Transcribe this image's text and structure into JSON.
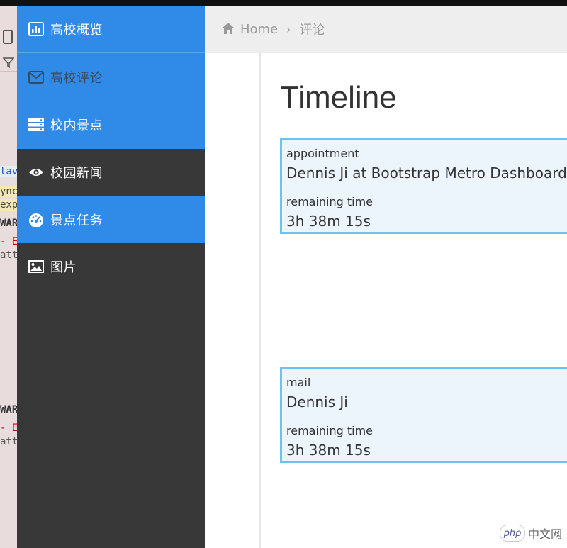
{
  "sidebar": {
    "items": [
      {
        "label": "高校概览",
        "icon": "bar-chart-icon"
      },
      {
        "label": "高校评论",
        "icon": "envelope-icon"
      },
      {
        "label": "校内景点",
        "icon": "server-icon"
      },
      {
        "label": "校园新闻",
        "icon": "eye-icon"
      },
      {
        "label": "景点任务",
        "icon": "dashboard-icon"
      },
      {
        "label": "图片",
        "icon": "image-icon"
      }
    ]
  },
  "breadcrumb": {
    "home": "Home",
    "separator": "›",
    "current": "评论"
  },
  "page": {
    "title": "Timeline"
  },
  "timeline": [
    {
      "type_label": "appointment",
      "title": "Dennis Ji at Bootstrap Metro Dashboard",
      "remaining_label": "remaining time",
      "remaining": "3h 38m 15s"
    },
    {
      "type_label": "mail",
      "title": "Dennis Ji",
      "remaining_label": "remaining time",
      "remaining": "3h 38m 15s"
    }
  ],
  "devtools": {
    "lines": [
      "lav.",
      "ync",
      "expe",
      "WARN",
      "- Er",
      "attp",
      "WARN",
      "- Er",
      "attp"
    ]
  },
  "watermark": {
    "logo": "php",
    "text": "中文网"
  },
  "colors": {
    "sidebar_bg": "#383838",
    "sidebar_active": "#2f8ae8",
    "card_bg": "#ecf5fc",
    "card_border": "#6cc3f0",
    "header_bg": "#eeeeee"
  }
}
